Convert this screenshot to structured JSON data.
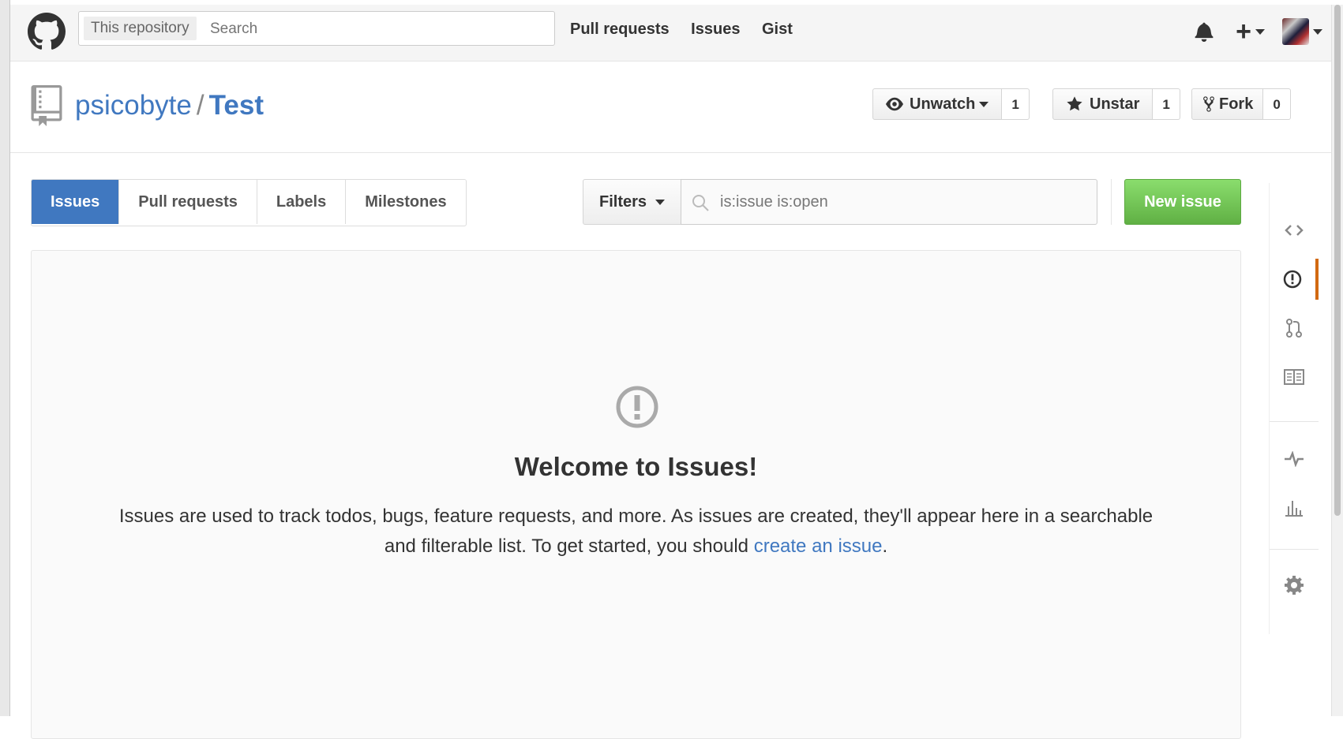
{
  "header": {
    "logo_icon": "github-octocat-icon",
    "search_scope": "This repository",
    "search_placeholder": "Search",
    "nav": [
      "Pull requests",
      "Issues",
      "Gist"
    ],
    "notifications_icon": "bell-icon",
    "create_icon": "plus-icon",
    "avatar": "user-avatar"
  },
  "repo": {
    "owner": "psicobyte",
    "separator": "/",
    "name": "Test",
    "icon": "repo-icon",
    "actions": {
      "watch_label": "Unwatch",
      "watch_count": "1",
      "star_label": "Unstar",
      "star_count": "1",
      "fork_label": "Fork",
      "fork_count": "0"
    }
  },
  "subnav": {
    "tabs": [
      "Issues",
      "Pull requests",
      "Labels",
      "Milestones"
    ],
    "active_tab": "Issues",
    "filters_label": "Filters",
    "filter_query": "is:issue is:open",
    "new_issue_label": "New issue"
  },
  "blankslate": {
    "icon": "issue-opened-icon",
    "title": "Welcome to Issues!",
    "text_before": "Issues are used to track todos, bugs, feature requests, and more. As issues are created, they'll appear here in a searchable and filterable list. To get started, you should ",
    "link_text": "create an issue",
    "text_after": "."
  },
  "sidebar": {
    "items": [
      "code-icon",
      "issues-icon",
      "pull-request-icon",
      "wiki-icon",
      "pulse-icon",
      "graph-icon",
      "settings-icon"
    ],
    "active": "issues-icon"
  },
  "colors": {
    "accent": "#4078c0",
    "success": "#60b044",
    "sidebar_active": "#d26911"
  }
}
